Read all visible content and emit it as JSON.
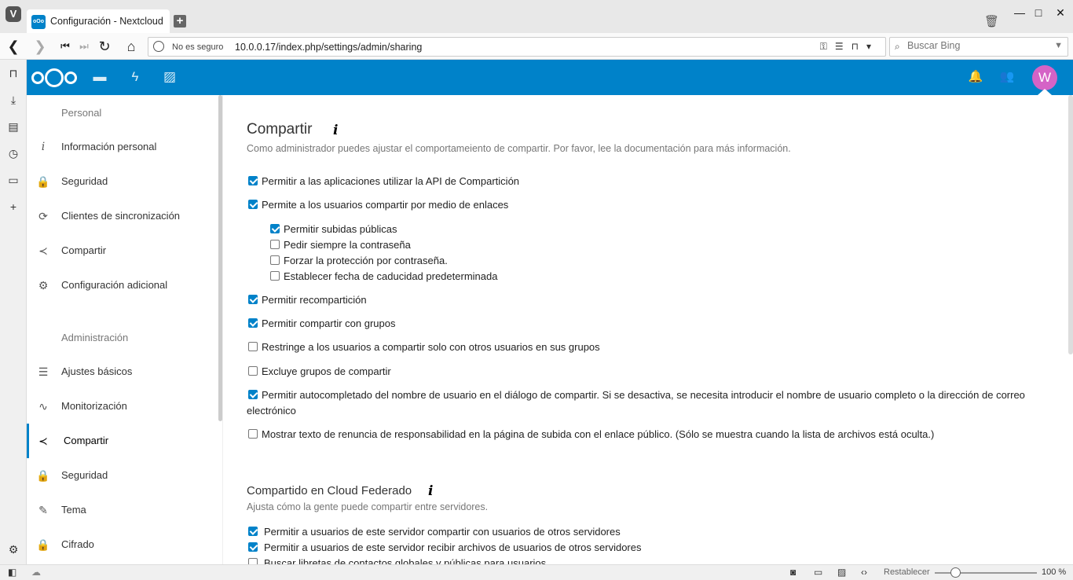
{
  "browser": {
    "tab_title": "Configuración - Nextcloud",
    "insecure_label": "No es seguro",
    "url": "10.0.0.17/index.php/settings/admin/sharing",
    "search_placeholder": "Buscar Bing"
  },
  "header": {
    "avatar_letter": "W"
  },
  "nav": {
    "personal_heading": "Personal",
    "personal_items": [
      {
        "label": "Información personal",
        "icon": "info-icon"
      },
      {
        "label": "Seguridad",
        "icon": "lock-icon"
      },
      {
        "label": "Clientes de sincronización",
        "icon": "sync-icon"
      },
      {
        "label": "Compartir",
        "icon": "share-icon"
      },
      {
        "label": "Configuración adicional",
        "icon": "gear-icon"
      }
    ],
    "admin_heading": "Administración",
    "admin_items": [
      {
        "label": "Ajustes básicos",
        "icon": "list-icon"
      },
      {
        "label": "Monitorización",
        "icon": "activity-icon"
      },
      {
        "label": "Compartir",
        "icon": "share-icon",
        "active": true
      },
      {
        "label": "Seguridad",
        "icon": "lock-icon"
      },
      {
        "label": "Tema",
        "icon": "brush-icon"
      },
      {
        "label": "Cifrado",
        "icon": "lock-icon"
      }
    ]
  },
  "sharing": {
    "title": "Compartir",
    "description": "Como administrador puedes ajustar el comportameiento de compartir. Por favor, lee la documentación para más información.",
    "options": [
      {
        "label": "Permitir a las aplicaciones utilizar la API de Compartición",
        "checked": true
      },
      {
        "label": "Permite a los usuarios compartir por medio de enlaces",
        "checked": true
      },
      {
        "label": "Permitir subidas públicas",
        "checked": true
      },
      {
        "label": "Pedir siempre la contraseña",
        "checked": false
      },
      {
        "label": "Forzar la protección por contraseña.",
        "checked": false
      },
      {
        "label": "Establecer fecha de caducidad predeterminada",
        "checked": false
      },
      {
        "label": "Permitir recompartición",
        "checked": true
      },
      {
        "label": "Permitir compartir con grupos",
        "checked": true
      },
      {
        "label": "Restringe a los usuarios a compartir solo con otros usuarios en sus grupos",
        "checked": false
      },
      {
        "label": "Excluye grupos de compartir",
        "checked": false
      },
      {
        "label": "Permitir autocompletado del nombre de usuario en el diálogo de compartir. Si se desactiva, se necesita introducir el nombre de usuario completo o la dirección de correo electrónico",
        "checked": true
      },
      {
        "label": "Mostrar texto de renuncia de responsabilidad en la página de subida con el enlace público. (Sólo se muestra cuando la lista de archivos está oculta.)",
        "checked": false
      }
    ]
  },
  "federated": {
    "title": "Compartido en Cloud Federado",
    "description": "Ajusta cómo la gente puede compartir entre servidores.",
    "options": [
      {
        "label": "Permitir a usuarios de este servidor compartir con usuarios de otros servidores",
        "checked": true
      },
      {
        "label": "Permitir a usuarios de este servidor recibir archivos de usuarios de otros servidores",
        "checked": true
      },
      {
        "label": "Buscar libretas de contactos globales y públicas para usuarios",
        "checked": false
      }
    ]
  },
  "statusbar": {
    "reset_label": "Restablecer",
    "zoom_label": "100 %"
  },
  "colors": {
    "brand": "#0082c9",
    "avatar": "#d563c6"
  }
}
